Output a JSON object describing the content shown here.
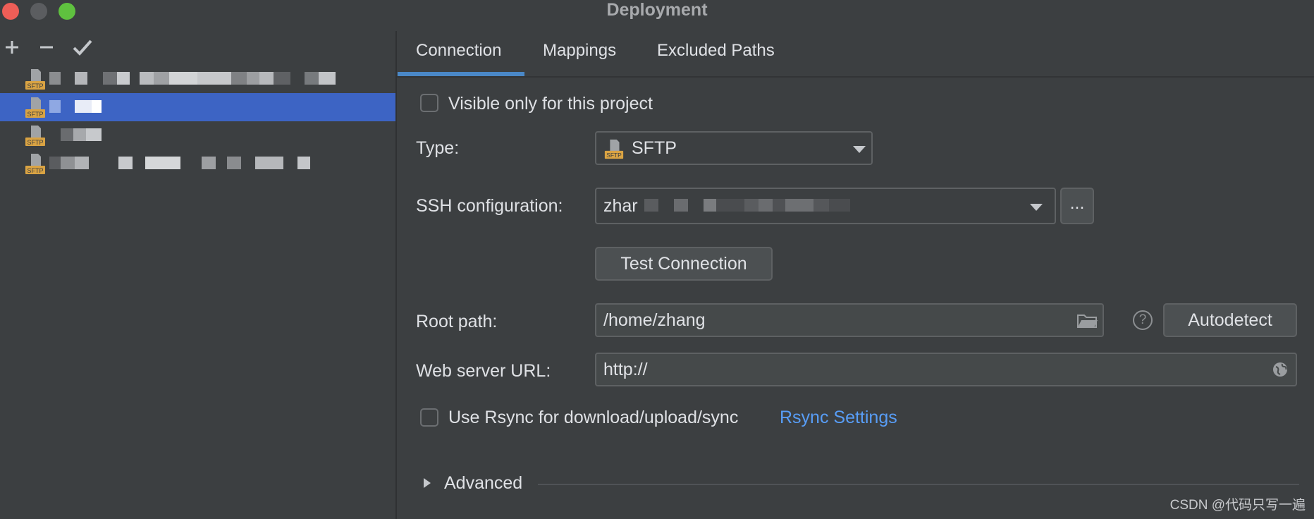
{
  "window": {
    "title": "Deployment"
  },
  "toolbar": {
    "add_icon": "plus-icon",
    "remove_icon": "minus-icon",
    "apply_icon": "check-icon"
  },
  "tree": {
    "items": [
      {
        "type": "SFTP"
      },
      {
        "type": "SFTP"
      },
      {
        "type": "SFTP"
      },
      {
        "type": "SFTP"
      }
    ]
  },
  "tabs": [
    {
      "label": "Connection"
    },
    {
      "label": "Mappings"
    },
    {
      "label": "Excluded Paths"
    }
  ],
  "connection": {
    "visible_only_label": "Visible only for this project",
    "type_label": "Type:",
    "type_value": "SFTP",
    "type_icon_text": "SFTP",
    "ssh_label": "SSH configuration:",
    "ssh_value": "zhar",
    "ssh_more_label": "...",
    "test_connection_label": "Test Connection",
    "root_path_label": "Root path:",
    "root_path_value": "/home/zhang",
    "help_label": "?",
    "autodetect_label": "Autodetect",
    "web_url_label": "Web server URL:",
    "web_url_value": "http://",
    "rsync_label": "Use Rsync for download/upload/sync",
    "rsync_settings_label": "Rsync Settings",
    "advanced_label": "Advanced"
  },
  "watermark": "CSDN @代码只写一遍",
  "colors": {
    "selection": "#3d64c4",
    "link": "#589df6",
    "tab_underline": "#4a88c7"
  }
}
